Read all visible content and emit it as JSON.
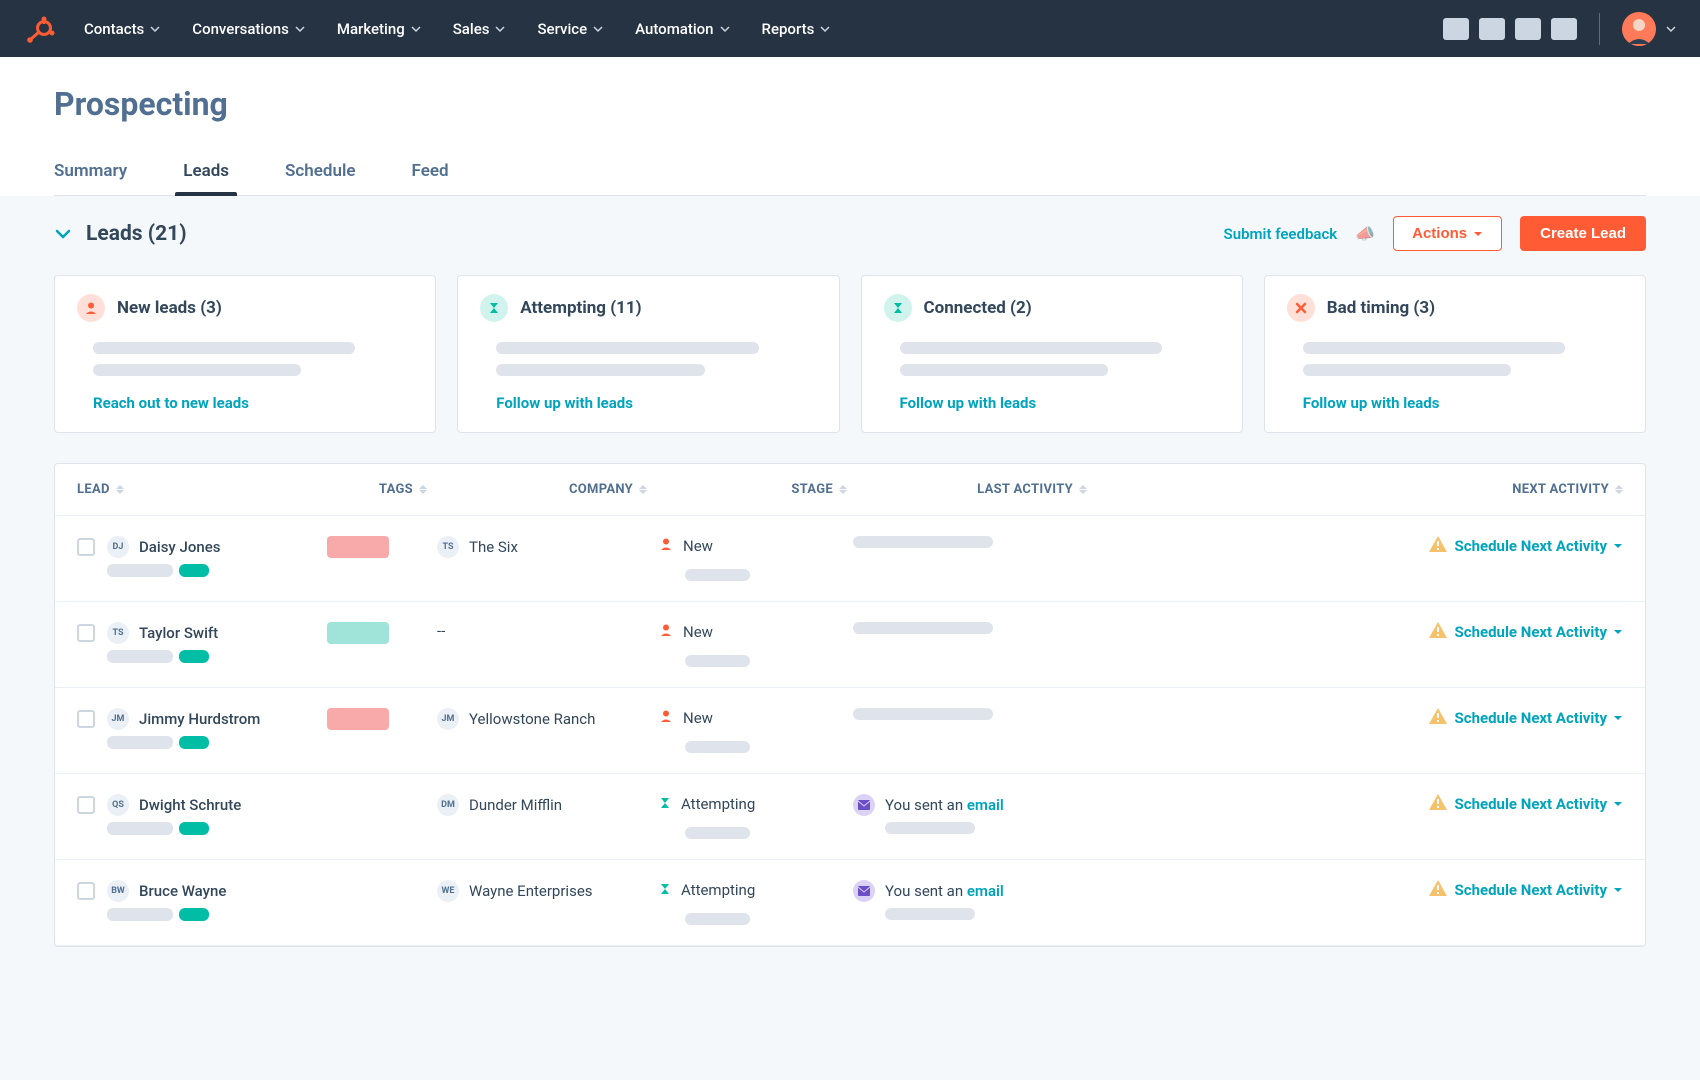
{
  "nav": {
    "items": [
      "Contacts",
      "Conversations",
      "Marketing",
      "Sales",
      "Service",
      "Automation",
      "Reports"
    ]
  },
  "page": {
    "title": "Prospecting",
    "tabs": [
      "Summary",
      "Leads",
      "Schedule",
      "Feed"
    ],
    "active_tab": 1
  },
  "section": {
    "title": "Leads (21)",
    "feedback": "Submit feedback",
    "actions_btn": "Actions",
    "create_btn": "Create Lead"
  },
  "cards": [
    {
      "title": "New leads (3)",
      "link": "Reach out to new leads",
      "icon": "person",
      "bg": "#ffe0d9",
      "fg": "#ff5c35"
    },
    {
      "title": "Attempting (11)",
      "link": "Follow up with leads",
      "icon": "hourglass",
      "bg": "#d1f3ee",
      "fg": "#00bda5"
    },
    {
      "title": "Connected (2)",
      "link": "Follow up with leads",
      "icon": "hourglass",
      "bg": "#d1f3ee",
      "fg": "#00bda5"
    },
    {
      "title": "Bad timing (3)",
      "link": "Follow up with leads",
      "icon": "x",
      "bg": "#ffe0d9",
      "fg": "#ff5c35"
    }
  ],
  "table": {
    "headers": [
      "LEAD",
      "TAGS",
      "COMPANY",
      "STAGE",
      "LAST ACTIVITY",
      "NEXT ACTIVITY"
    ],
    "rows": [
      {
        "initials": "DJ",
        "name": "Daisy Jones",
        "tag_color": "#f8a9a9",
        "company_initials": "TS",
        "company": "The Six",
        "stage": "New",
        "stage_icon": "person",
        "last_activity": null,
        "next": "Schedule Next Activity"
      },
      {
        "initials": "TS",
        "name": "Taylor Swift",
        "tag_color": "#9fe3d9",
        "company_initials": null,
        "company": "--",
        "stage": "New",
        "stage_icon": "person",
        "last_activity": null,
        "next": "Schedule Next Activity"
      },
      {
        "initials": "JM",
        "name": "Jimmy Hurdstrom",
        "tag_color": "#f8a9a9",
        "company_initials": "JM",
        "company": "Yellowstone Ranch",
        "stage": "New",
        "stage_icon": "person",
        "last_activity": null,
        "next": "Schedule Next Activity"
      },
      {
        "initials": "QS",
        "name": "Dwight Schrute",
        "tag_color": null,
        "company_initials": "DM",
        "company": "Dunder Mifflin",
        "stage": "Attempting",
        "stage_icon": "hourglass",
        "last_activity": {
          "prefix": "You sent an ",
          "link": "email"
        },
        "next": "Schedule Next Activity"
      },
      {
        "initials": "BW",
        "name": "Bruce Wayne",
        "tag_color": null,
        "company_initials": "WE",
        "company": "Wayne Enterprises",
        "stage": "Attempting",
        "stage_icon": "hourglass",
        "last_activity": {
          "prefix": "You sent an ",
          "link": "email"
        },
        "next": "Schedule Next Activity"
      }
    ]
  }
}
